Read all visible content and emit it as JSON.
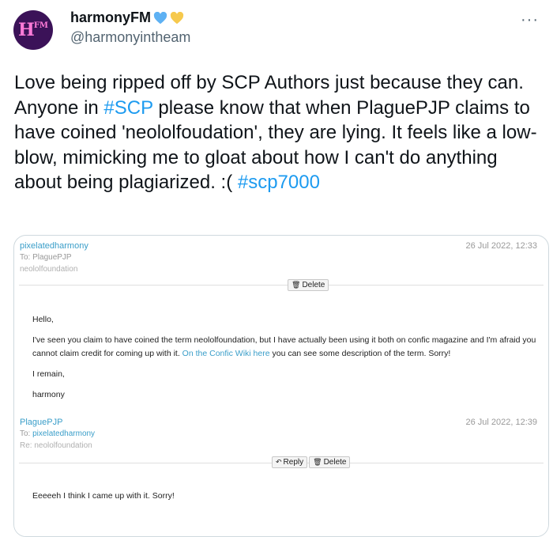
{
  "user": {
    "display_name": "harmonyFM",
    "handle": "@harmonyintheam",
    "avatar_text": "HFM",
    "emoji": [
      "blue-heart",
      "yellow-heart"
    ]
  },
  "more_label": "···",
  "tweet": {
    "t1": "Love being ripped off by SCP Authors just because they can. Anyone in ",
    "h1": "#SCP",
    "t2": " please know that when PlaguePJP claims to have coined 'neololfoudation', they are lying. It feels like a low-blow, mimicking me to gloat about how I can't do anything about being plagiarized. :( ",
    "h2": "#scp7000"
  },
  "pm1": {
    "from": "pixelatedharmony",
    "to": "To: PlaguePJP",
    "subject": "neololfoundation",
    "date": "26 Jul 2022, 12:33",
    "delete_label": "Delete",
    "greeting": "Hello,",
    "body_a": "I've seen you claim to have coined the term neololfoundation, but I have actually been using it both on confic magazine and I'm afraid you cannot claim credit for coming up with it. ",
    "body_link": "On the Confic Wiki here",
    "body_b": " you can see some description of the term. Sorry!",
    "closing": "I remain,",
    "signature": "harmony"
  },
  "pm2": {
    "from": "PlaguePJP",
    "to_prefix": "To: ",
    "to_user": "pixelatedharmony",
    "subject": "Re: neololfoundation",
    "date": "26 Jul 2022, 12:39",
    "reply_label": "Reply",
    "delete_label": "Delete",
    "body": "Eeeeeh I think I came up with it. Sorry!"
  },
  "colors": {
    "hashtag": "#1d9bf0",
    "wiki_link": "#3a9ec9",
    "avatar_bg": "#3b1258",
    "heart_blue": "#5eb1f3",
    "heart_yellow": "#f6c94d"
  }
}
